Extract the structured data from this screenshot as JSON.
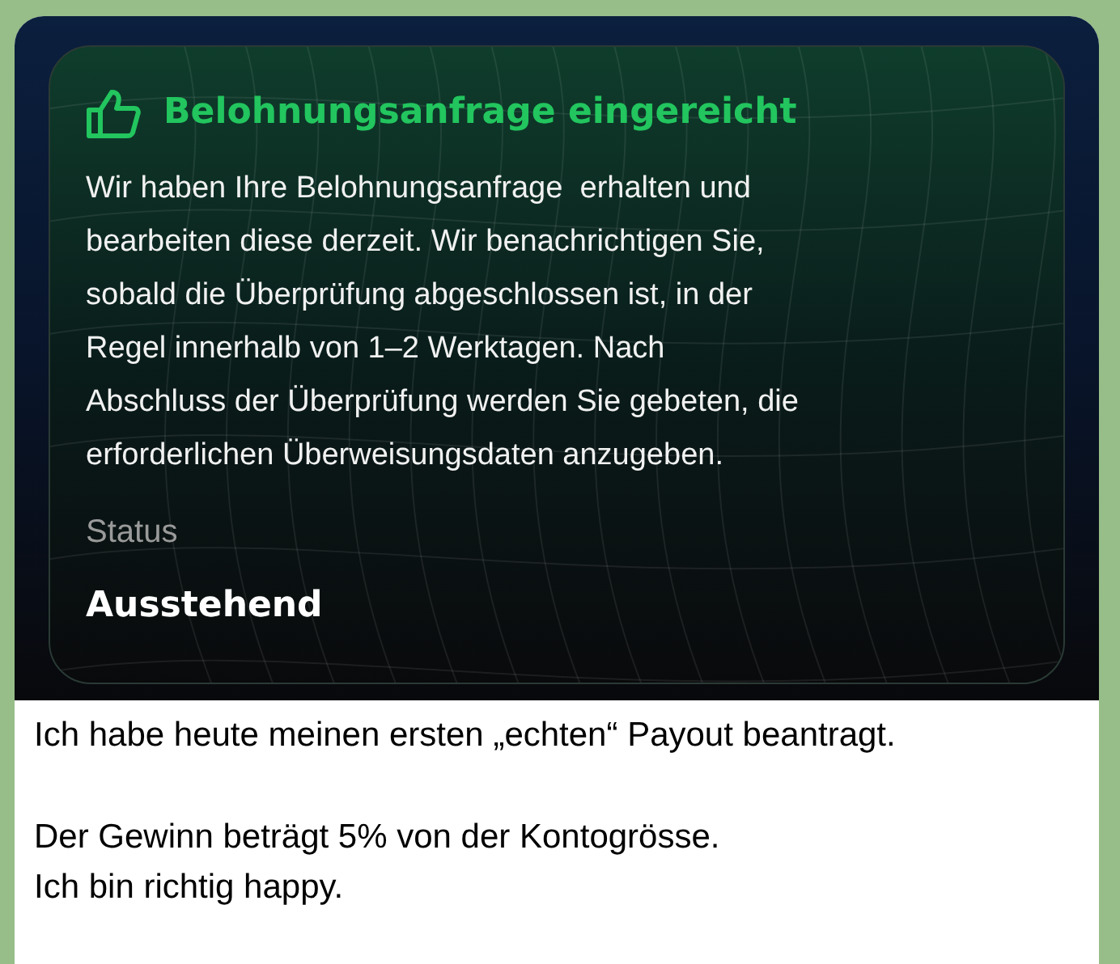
{
  "image_card": {
    "title": "Belohnungsanfrage eingereicht",
    "body_lines": [
      "Wir haben Ihre Belohnungsanfrage  erhalten und",
      "bearbeiten diese derzeit. Wir benachrichtigen Sie,",
      "sobald die Überprüfung abgeschlossen ist, in der",
      "Regel innerhalb von 1–2 Werktagen. Nach",
      "Abschluss der Überprüfung werden Sie gebeten, die",
      "erforderlichen Überweisungsdaten anzugeben."
    ],
    "status_label": "Status",
    "status_value": "Ausstehend"
  },
  "caption_paragraphs": [
    [
      "Ich habe heute meinen ersten „echten“ Payout beantragt."
    ],
    [
      "Der Gewinn beträgt 5% von der Kontogrösse.",
      "Ich bin richtig happy."
    ]
  ]
}
